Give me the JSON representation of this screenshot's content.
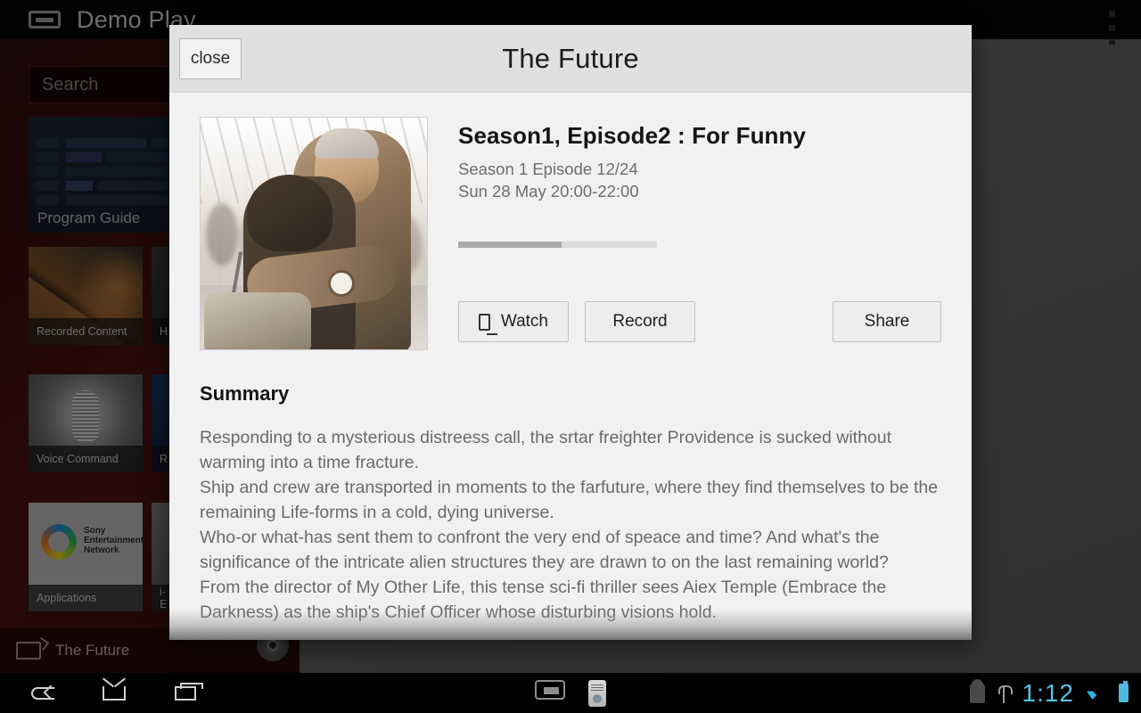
{
  "background_app": {
    "app_title": "Demo Play",
    "app_icon": "tv-icon",
    "search_placeholder": "Search",
    "overflow_menu_icon": "overflow-menu-icon",
    "tiles": [
      {
        "label": "Program Guide",
        "art": "guide"
      },
      {
        "label": "Recorded Content",
        "art": "film"
      },
      {
        "label": "H",
        "art": "dark"
      },
      {
        "label": "Voice Command",
        "art": "mic"
      },
      {
        "label": "R",
        "art": "blue"
      },
      {
        "label": "Applications",
        "art": "sen"
      },
      {
        "label": "i-\nE",
        "art": "gray"
      }
    ],
    "sen_logo_text": "Sony\nEntertainment\nNetwork",
    "now_playing": "The Future",
    "now_playing_icon": "cast-icon",
    "disc_icon": "disc-icon"
  },
  "dialog": {
    "title": "The Future",
    "close_label": "close",
    "thumbnail_alt": "embracing-couple-airport-photo",
    "episode": {
      "title": "Season1, Episode2 : For Funny",
      "season_line": "Season 1 Episode 12/24",
      "schedule_line": "Sun 28 May 20:00-22:00"
    },
    "progress": {
      "percent": 52
    },
    "actions": {
      "watch_label": "Watch",
      "watch_icon": "monitor-icon",
      "record_label": "Record",
      "share_label": "Share"
    },
    "summary": {
      "heading": "Summary",
      "text": "Responding to a mysterious distreess call, the srtar freighter Providence is sucked without warming into a time fracture.\nShip and crew are transported in moments to the farfuture, where they find themselves to be the remaining Life-forms in a cold, dying universe.\nWho-or what-has sent them to confront the very end of speace and time? And what's the significance of the intricate alien structures they are drawn to on the last remaining world?\nFrom the director of My Other Life, this tense sci-fi thriller sees Aiex Temple (Embrace the Darkness) as the ship's Chief Officer whose disturbing visions hold."
    }
  },
  "system_bar": {
    "back_icon": "back-icon",
    "home_icon": "home-icon",
    "recents_icon": "recent-apps-icon",
    "screen_icon": "screen-mirror-icon",
    "remote_icon": "remote-control-icon",
    "android_icon": "android-debug-icon",
    "usb_icon": "usb-icon",
    "clock": "1:12",
    "wifi_icon": "wifi-icon",
    "battery_icon": "battery-icon"
  },
  "colors": {
    "accent_cyan": "#53c3e8",
    "dialog_bg": "#f1f1f1",
    "dialog_header_bg": "#e0e0e0",
    "left_panel_red": "#3d0f0f"
  }
}
